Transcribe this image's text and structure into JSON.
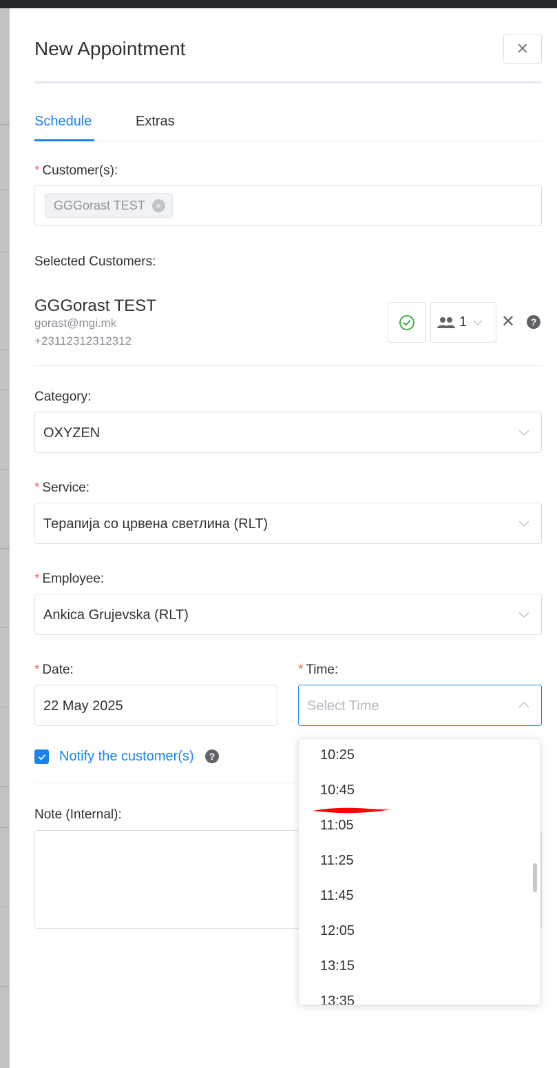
{
  "dialog": {
    "title": "New Appointment",
    "close_symbol": "✕"
  },
  "tabs": [
    {
      "label": "Schedule",
      "active": true
    },
    {
      "label": "Extras",
      "active": false
    }
  ],
  "customers": {
    "label": "Customer(s):",
    "required_mark": "*",
    "selected_tag": "GGGorast TEST",
    "tag_close_symbol": "×"
  },
  "selected_customers": {
    "label": "Selected Customers:",
    "name": "GGGorast TEST",
    "email": "gorast@mgi.mk",
    "phone": "+23112312312312",
    "status_icon": "check-circle-icon",
    "persons_count": "1",
    "remove_symbol": "✕",
    "help_symbol": "?"
  },
  "category": {
    "label": "Category:",
    "value": "OXYZEN"
  },
  "service": {
    "label": "Service:",
    "required_mark": "*",
    "value": "Терапија со црвена светлина (RLT)"
  },
  "employee": {
    "label": "Employee:",
    "required_mark": "*",
    "value": "Ankica Grujevska (RLT)"
  },
  "date": {
    "label": "Date:",
    "required_mark": "*",
    "value": "22 May 2025"
  },
  "time": {
    "label": "Time:",
    "required_mark": "*",
    "placeholder": "Select Time",
    "options": [
      "10:25",
      "10:45",
      "11:05",
      "11:25",
      "11:45",
      "12:05",
      "13:15",
      "13:35"
    ]
  },
  "notify": {
    "label": "Notify the customer(s)",
    "checked": true,
    "help_symbol": "?"
  },
  "note": {
    "label": "Note (Internal):",
    "value": ""
  },
  "colors": {
    "accent": "#1a84ee",
    "required": "#f56c6c",
    "success": "#3cb043",
    "annotation": "#ff0000"
  }
}
